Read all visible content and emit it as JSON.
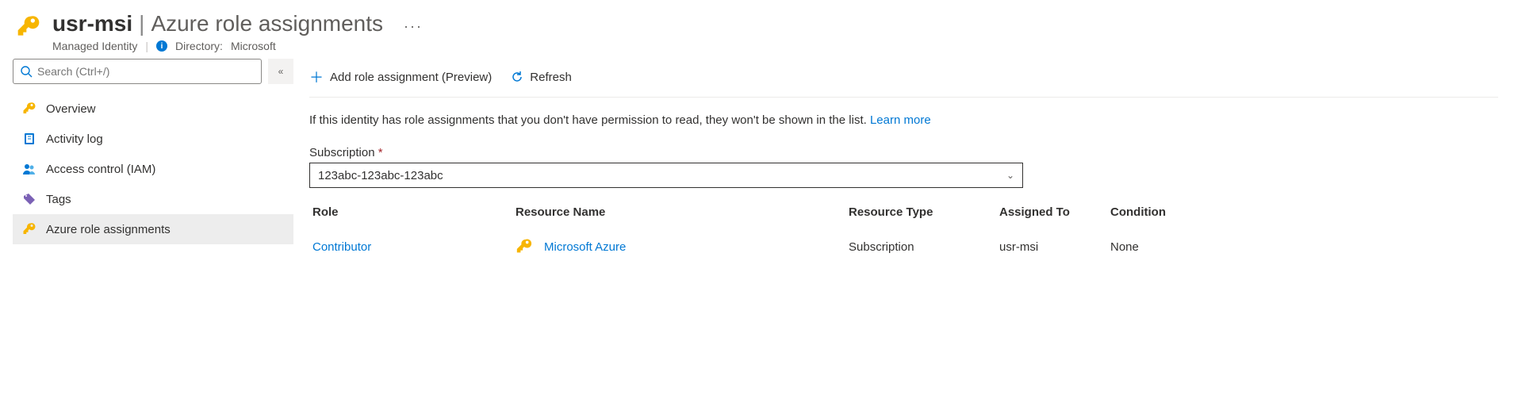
{
  "header": {
    "resource_name": "usr-msi",
    "page_title": "Azure role assignments",
    "resource_type": "Managed Identity",
    "directory_label": "Directory:",
    "directory_value": "Microsoft"
  },
  "sidebar": {
    "search_placeholder": "Search (Ctrl+/)",
    "items": [
      {
        "label": "Overview"
      },
      {
        "label": "Activity log"
      },
      {
        "label": "Access control (IAM)"
      },
      {
        "label": "Tags"
      },
      {
        "label": "Azure role assignments"
      }
    ]
  },
  "toolbar": {
    "add_label": "Add role assignment (Preview)",
    "refresh_label": "Refresh"
  },
  "main": {
    "notice_text": "If this identity has role assignments that you don't have permission to read, they won't be shown in the list.",
    "learn_more": "Learn more",
    "subscription_label": "Subscription",
    "subscription_value": "123abc-123abc-123abc",
    "columns": {
      "role": "Role",
      "resource_name": "Resource Name",
      "resource_type": "Resource Type",
      "assigned_to": "Assigned To",
      "condition": "Condition"
    },
    "rows": [
      {
        "role": "Contributor",
        "resource_name": "Microsoft Azure",
        "resource_type": "Subscription",
        "assigned_to": "usr-msi",
        "condition": "None"
      }
    ]
  }
}
